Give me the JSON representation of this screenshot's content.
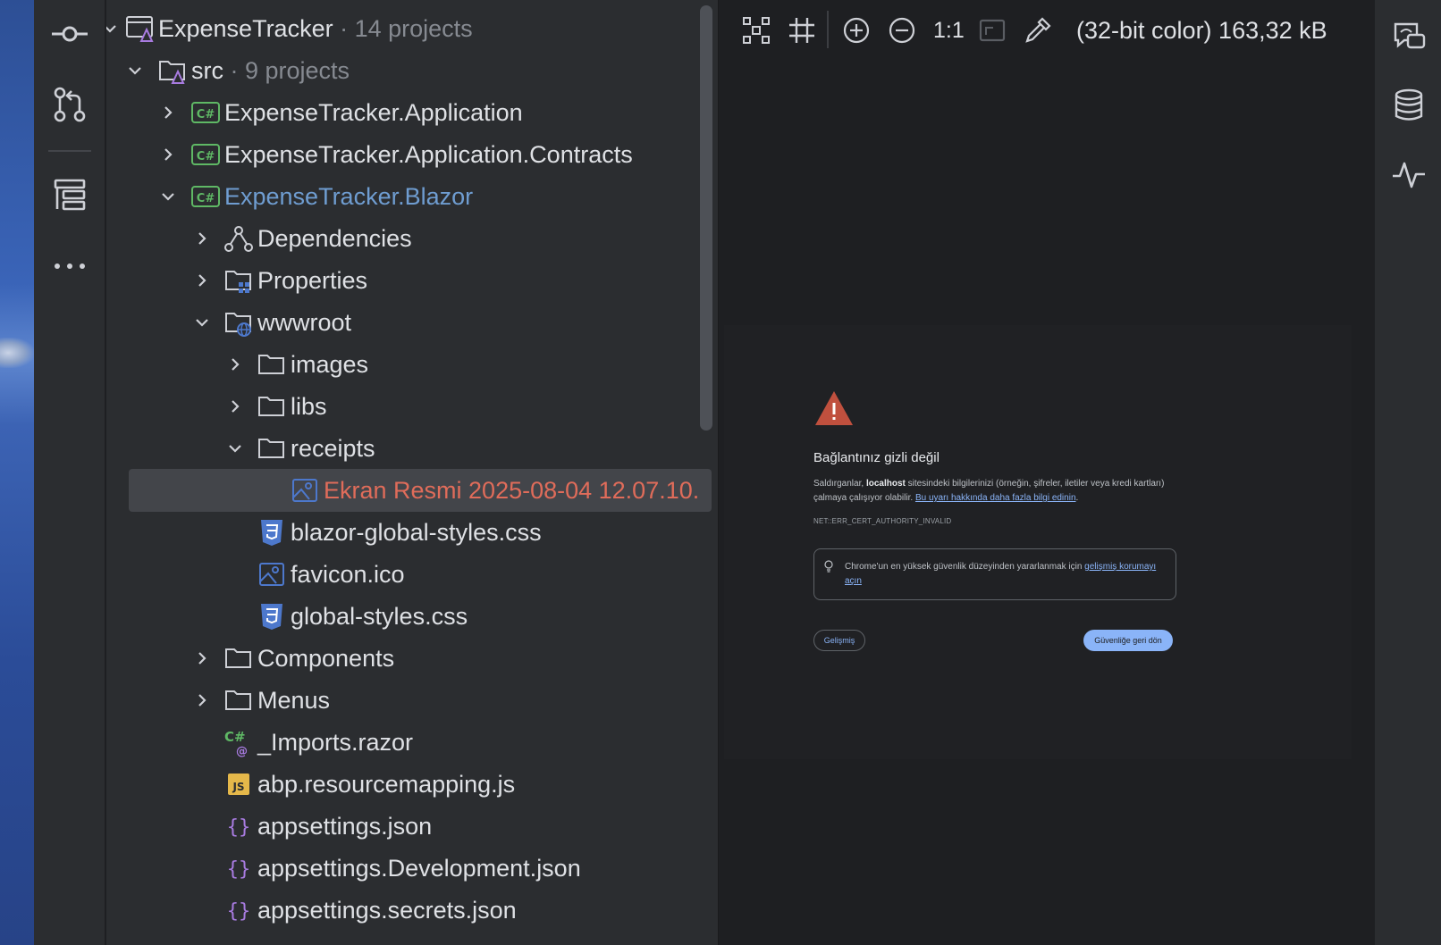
{
  "left_toolbar": {
    "items": [
      {
        "name": "commit",
        "icon": "commit-icon"
      },
      {
        "name": "pull-requests",
        "icon": "pull-request-icon"
      },
      {
        "name": "structure",
        "icon": "structure-icon"
      },
      {
        "name": "more",
        "icon": "more-icon"
      }
    ]
  },
  "tree": {
    "rows": [
      {
        "label": "ExpenseTracker",
        "suffix": " · 14 projects",
        "icon": "solution-icon",
        "expanded": true
      },
      {
        "label": "src",
        "suffix": " · 9 projects",
        "icon": "solution-folder-icon",
        "expanded": true
      },
      {
        "label": "ExpenseTracker.Application",
        "icon": "csharp-project-icon",
        "expanded": false
      },
      {
        "label": "ExpenseTracker.Application.Contracts",
        "icon": "csharp-project-icon",
        "expanded": false
      },
      {
        "label": "ExpenseTracker.Blazor",
        "icon": "csharp-project-icon",
        "expanded": true
      },
      {
        "label": "Dependencies",
        "icon": "dependencies-icon",
        "expanded": false
      },
      {
        "label": "Properties",
        "icon": "properties-folder-icon",
        "expanded": false
      },
      {
        "label": "wwwroot",
        "icon": "web-folder-icon",
        "expanded": true
      },
      {
        "label": "images",
        "icon": "folder-icon",
        "expanded": false
      },
      {
        "label": "libs",
        "icon": "folder-icon",
        "expanded": false
      },
      {
        "label": "receipts",
        "icon": "folder-icon",
        "expanded": true
      },
      {
        "label": "Ekran Resmi 2025-08-04 12.07.10.",
        "icon": "image-file-icon",
        "selected": true
      },
      {
        "label": "blazor-global-styles.css",
        "icon": "css-file-icon"
      },
      {
        "label": "favicon.ico",
        "icon": "image-file-icon"
      },
      {
        "label": "global-styles.css",
        "icon": "css-file-icon"
      },
      {
        "label": "Components",
        "icon": "folder-icon",
        "expanded": false
      },
      {
        "label": "Menus",
        "icon": "folder-icon",
        "expanded": false
      },
      {
        "label": "_Imports.razor",
        "icon": "razor-file-icon"
      },
      {
        "label": "abp.resourcemapping.js",
        "icon": "js-file-icon"
      },
      {
        "label": "appsettings.json",
        "icon": "json-file-icon"
      },
      {
        "label": "appsettings.Development.json",
        "icon": "json-file-icon"
      },
      {
        "label": "appsettings.secrets.json",
        "icon": "json-file-icon"
      }
    ]
  },
  "viewer": {
    "toolbar": {
      "zoom_ratio_label": "1:1",
      "image_info": "(32-bit color) 163,32 kB"
    },
    "screenshot": {
      "title": "Bağlantınız gizli değil",
      "body_prefix": "Saldırganlar, ",
      "body_host": "localhost",
      "body_middle": " sitesindeki bilgilerinizi (örneğin, şifreler, iletiler veya kredi kartları) çalmaya çalışıyor olabilir. ",
      "body_link": "Bu uyarı hakkında daha fazla bilgi edinin",
      "body_end": ".",
      "error_code": "NET::ERR_CERT_AUTHORITY_INVALID",
      "tip_text": "Chrome'un en yüksek güvenlik düzeyinden yararlanmak için ",
      "tip_link": "gelişmiş korumayı açın",
      "advanced_label": "Gelişmiş",
      "back_label": "Güvenliğe geri dön"
    }
  },
  "right_toolbar": {
    "items": [
      {
        "name": "ai-assistant",
        "icon": "ai-chat-icon"
      },
      {
        "name": "database",
        "icon": "database-icon"
      },
      {
        "name": "profiler",
        "icon": "pulse-icon"
      }
    ]
  },
  "colors": {
    "panel_bg": "#2b2d30",
    "editor_bg": "#1e1f22",
    "selection": "#43454a",
    "project_blue": "#6f9dd1",
    "unversioned_red": "#e06c5a",
    "csharp_green": "#5fb865",
    "css_blue": "#4d78cc"
  }
}
